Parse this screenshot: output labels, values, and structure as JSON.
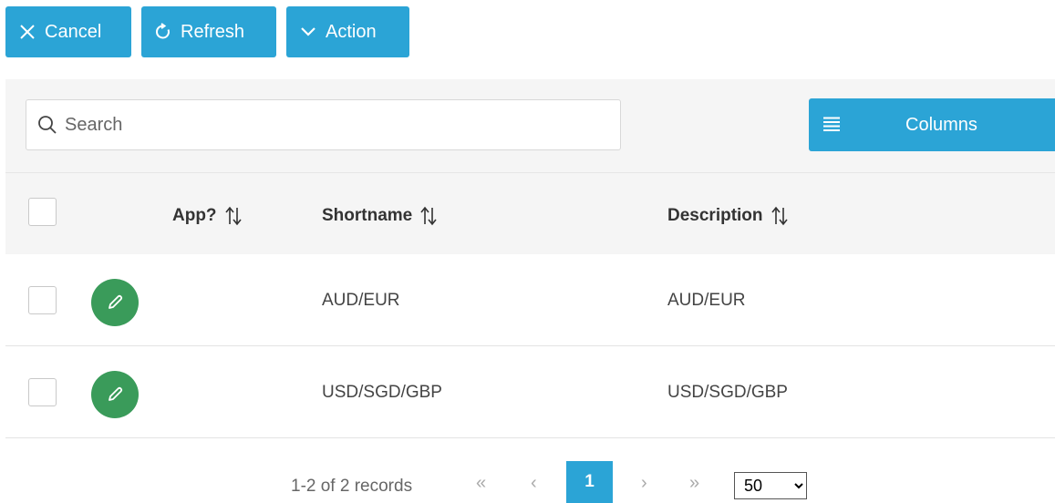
{
  "toolbar": {
    "cancel_label": "Cancel",
    "refresh_label": "Refresh",
    "action_label": "Action"
  },
  "search": {
    "placeholder": "Search",
    "value": ""
  },
  "columns_button": {
    "label": "Columns"
  },
  "table": {
    "headers": {
      "app": "App?",
      "shortname": "Shortname",
      "description": "Description"
    },
    "rows": [
      {
        "shortname": "AUD/EUR",
        "description": "AUD/EUR"
      },
      {
        "shortname": "USD/SGD/GBP",
        "description": "USD/SGD/GBP"
      }
    ]
  },
  "pager": {
    "info": "1-2 of 2 records",
    "first": "«",
    "prev": "‹",
    "current_page": "1",
    "next": "›",
    "last": "»",
    "page_size": "50",
    "page_size_options": [
      "50"
    ]
  },
  "colors": {
    "accent": "#2ba4d6",
    "edit_button": "#3a9b5a",
    "header_bg": "#f5f5f5"
  },
  "icons": {
    "cancel": "close-icon",
    "refresh": "refresh-icon",
    "action": "chevron-down-icon",
    "search": "search-icon",
    "columns": "list-icon",
    "sort": "sort-icon",
    "edit": "pencil-icon"
  }
}
